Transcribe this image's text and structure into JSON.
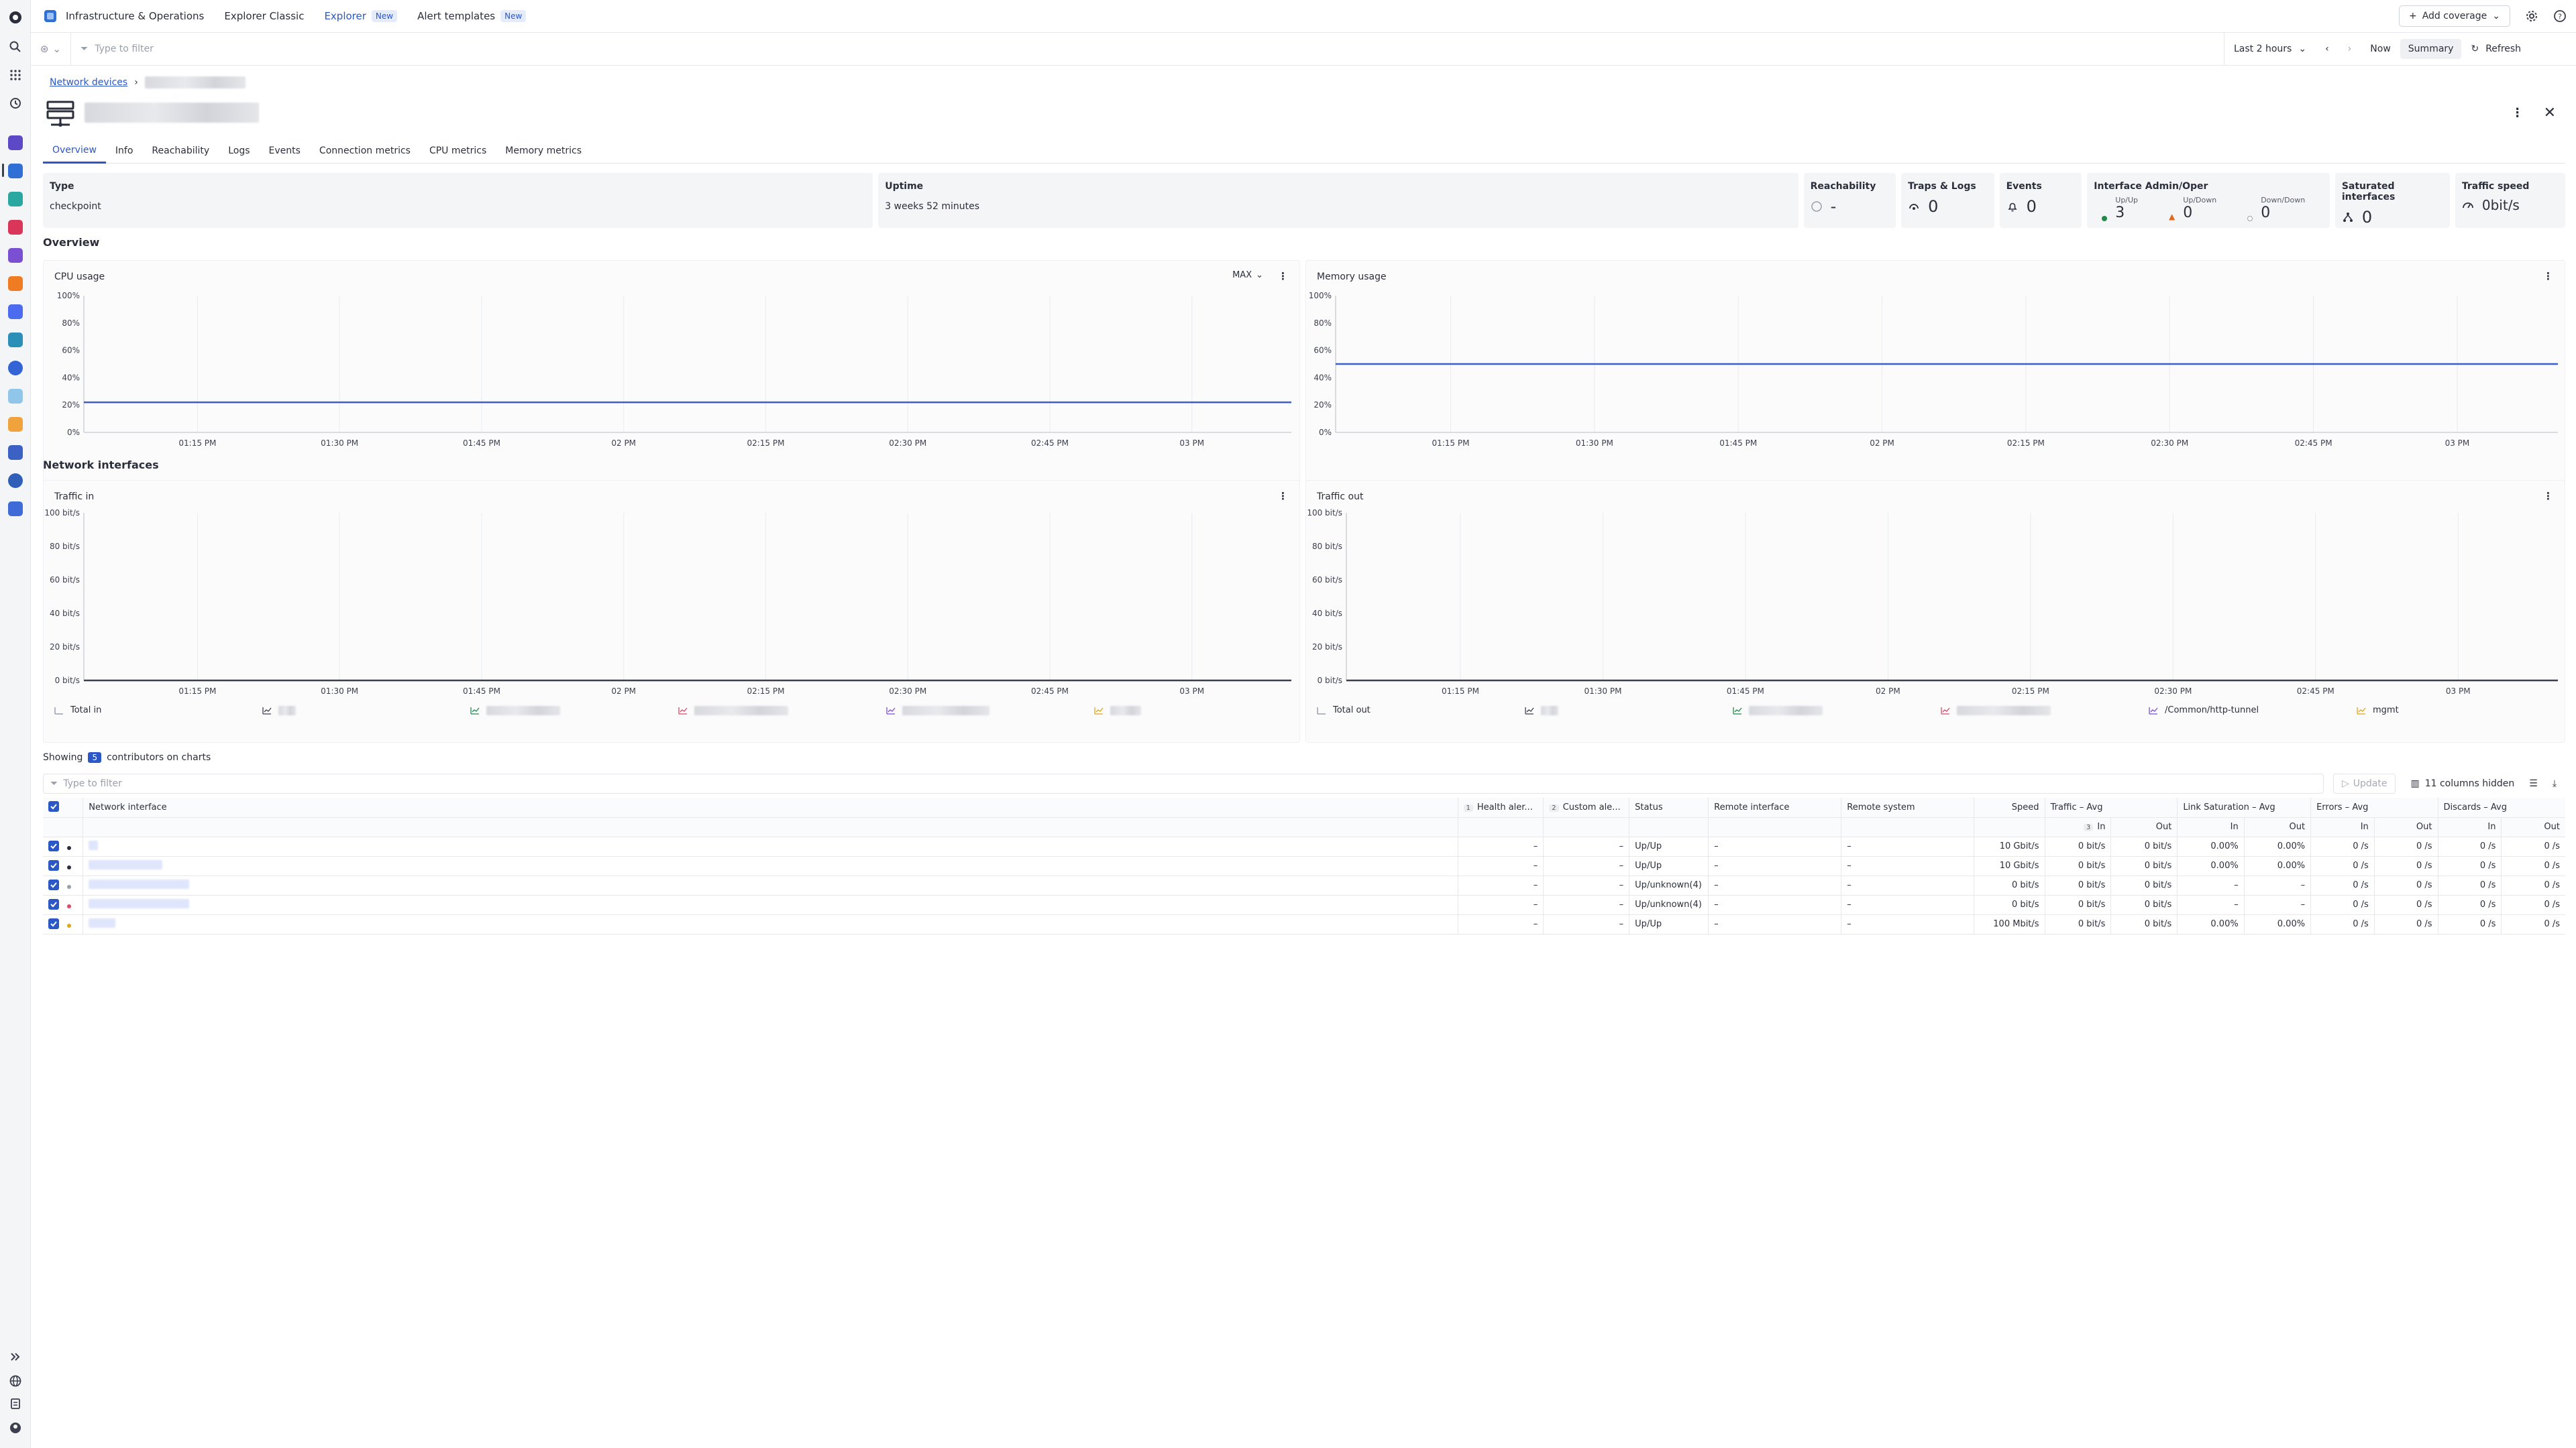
{
  "topbar": {
    "app_name": "Infrastructure & Operations",
    "nav": [
      {
        "label": "Explorer Classic",
        "badge": ""
      },
      {
        "label": "Explorer",
        "badge": "New"
      },
      {
        "label": "Alert templates",
        "badge": "New"
      }
    ],
    "add_coverage": "Add coverage"
  },
  "filterbar": {
    "placeholder": "Type to filter",
    "timeframe": "Last 2 hours",
    "now": "Now",
    "summary": "Summary",
    "refresh": "Refresh"
  },
  "page": {
    "breadcrumb_link": "Network devices",
    "tabs": [
      "Overview",
      "Info",
      "Reachability",
      "Logs",
      "Events",
      "Connection metrics",
      "CPU metrics",
      "Memory metrics"
    ]
  },
  "info": {
    "type_label": "Type",
    "type_value": "checkpoint",
    "uptime_label": "Uptime",
    "uptime_value": "3 weeks 52 minutes",
    "reachability_label": "Reachability",
    "reachability_value": "-",
    "traps_label": "Traps & Logs",
    "traps_value": "0",
    "events_label": "Events",
    "events_value": "0",
    "interface_label": "Interface Admin/Oper",
    "upup_label": "Up/Up",
    "upup_value": "3",
    "updown_label": "Up/Down",
    "updown_value": "0",
    "downdown_label": "Down/Down",
    "downdown_value": "0",
    "saturated_label": "Saturated interfaces",
    "saturated_value": "0",
    "traffic_label": "Traffic speed",
    "traffic_value": "0bit/s"
  },
  "sections": {
    "overview": "Overview",
    "network": "Network interfaces"
  },
  "chart_data": [
    {
      "type": "line",
      "title": "CPU usage",
      "aggregation": "MAX",
      "x": [
        "01:15 PM",
        "01:30 PM",
        "01:45 PM",
        "02 PM",
        "02:15 PM",
        "02:30 PM",
        "02:45 PM",
        "03 PM"
      ],
      "yticks": [
        "0%",
        "20%",
        "40%",
        "60%",
        "80%",
        "100%"
      ],
      "ylim": [
        0,
        100
      ],
      "series": [
        {
          "values": [
            22,
            22,
            22,
            22,
            22,
            22,
            22,
            22
          ]
        }
      ],
      "color": "#3a5fcd"
    },
    {
      "type": "line",
      "title": "Memory usage",
      "x": [
        "01:15 PM",
        "01:30 PM",
        "01:45 PM",
        "02 PM",
        "02:15 PM",
        "02:30 PM",
        "02:45 PM",
        "03 PM"
      ],
      "yticks": [
        "0%",
        "20%",
        "40%",
        "60%",
        "80%",
        "100%"
      ],
      "ylim": [
        0,
        100
      ],
      "series": [
        {
          "values": [
            50,
            50,
            50,
            50,
            50,
            50,
            50,
            50
          ]
        }
      ],
      "color": "#3a5fcd"
    },
    {
      "type": "line",
      "title": "Traffic in",
      "x": [
        "01:15 PM",
        "01:30 PM",
        "01:45 PM",
        "02 PM",
        "02:15 PM",
        "02:30 PM",
        "02:45 PM",
        "03 PM"
      ],
      "yticks": [
        "0 bit/s",
        "20 bit/s",
        "40 bit/s",
        "60 bit/s",
        "80 bit/s",
        "100 bit/s"
      ],
      "ylim": [
        0,
        100
      ],
      "series": [
        {
          "name": "Total in",
          "values": [
            0,
            0,
            0,
            0,
            0,
            0,
            0,
            0
          ]
        }
      ],
      "color": "#3c3f4d"
    },
    {
      "type": "line",
      "title": "Traffic out",
      "x": [
        "01:15 PM",
        "01:30 PM",
        "01:45 PM",
        "02 PM",
        "02:15 PM",
        "02:30 PM",
        "02:45 PM",
        "03 PM"
      ],
      "yticks": [
        "0 bit/s",
        "20 bit/s",
        "40 bit/s",
        "60 bit/s",
        "80 bit/s",
        "100 bit/s"
      ],
      "ylim": [
        0,
        100
      ],
      "series": [
        {
          "name": "Total out",
          "values": [
            0,
            0,
            0,
            0,
            0,
            0,
            0,
            0
          ]
        }
      ],
      "color": "#3c3f4d"
    }
  ],
  "legend_in": [
    "Total in"
  ],
  "legend_out": [
    "Total out",
    "/Common/http-tunnel",
    "mgmt"
  ],
  "table": {
    "showing": "Showing",
    "showing_count": "5",
    "showing_suffix": "contributors on charts",
    "filter_placeholder": "Type to filter",
    "update": "Update",
    "hidden": "11 columns hidden",
    "headers": {
      "name": "Network interface",
      "health": "Health aler...",
      "custom": "Custom ale...",
      "status": "Status",
      "remote_if": "Remote interface",
      "remote_sys": "Remote system",
      "speed": "Speed",
      "traffic": "Traffic – Avg",
      "link": "Link Saturation – Avg",
      "errors": "Errors – Avg",
      "discards": "Discards – Avg",
      "in": "In",
      "out": "Out",
      "sort1": "1",
      "sort2": "2",
      "sort3": "3"
    },
    "rows": [
      {
        "dot": "#2b2f3b",
        "health": "–",
        "custom": "–",
        "status": "Up/Up",
        "rif": "–",
        "rsys": "–",
        "speed": "10 Gbit/s",
        "tin": "0 bit/s",
        "tout": "0 bit/s",
        "lin": "0.00%",
        "lout": "0.00%",
        "ein": "0 /s",
        "eout": "0 /s",
        "din": "0 /s",
        "dout": "0 /s"
      },
      {
        "dot": "#2b2f3b",
        "health": "–",
        "custom": "–",
        "status": "Up/Up",
        "rif": "–",
        "rsys": "–",
        "speed": "10 Gbit/s",
        "tin": "0 bit/s",
        "tout": "0 bit/s",
        "lin": "0.00%",
        "lout": "0.00%",
        "ein": "0 /s",
        "eout": "0 /s",
        "din": "0 /s",
        "dout": "0 /s"
      },
      {
        "dot": "#9aa0ab",
        "health": "–",
        "custom": "–",
        "status": "Up/unknown(4)",
        "rif": "–",
        "rsys": "–",
        "speed": "0 bit/s",
        "tin": "0 bit/s",
        "tout": "0 bit/s",
        "lin": "–",
        "lout": "–",
        "ein": "0 /s",
        "eout": "0 /s",
        "din": "0 /s",
        "dout": "0 /s"
      },
      {
        "dot": "#d94a6b",
        "health": "–",
        "custom": "–",
        "status": "Up/unknown(4)",
        "rif": "–",
        "rsys": "–",
        "speed": "0 bit/s",
        "tin": "0 bit/s",
        "tout": "0 bit/s",
        "lin": "–",
        "lout": "–",
        "ein": "0 /s",
        "eout": "0 /s",
        "din": "0 /s",
        "dout": "0 /s"
      },
      {
        "dot": "#e3a417",
        "health": "–",
        "custom": "–",
        "status": "Up/Up",
        "rif": "–",
        "rsys": "–",
        "speed": "100 Mbit/s",
        "tin": "0 bit/s",
        "tout": "0 bit/s",
        "lin": "0.00%",
        "lout": "0.00%",
        "ein": "0 /s",
        "eout": "0 /s",
        "din": "0 /s",
        "dout": "0 /s"
      }
    ]
  }
}
